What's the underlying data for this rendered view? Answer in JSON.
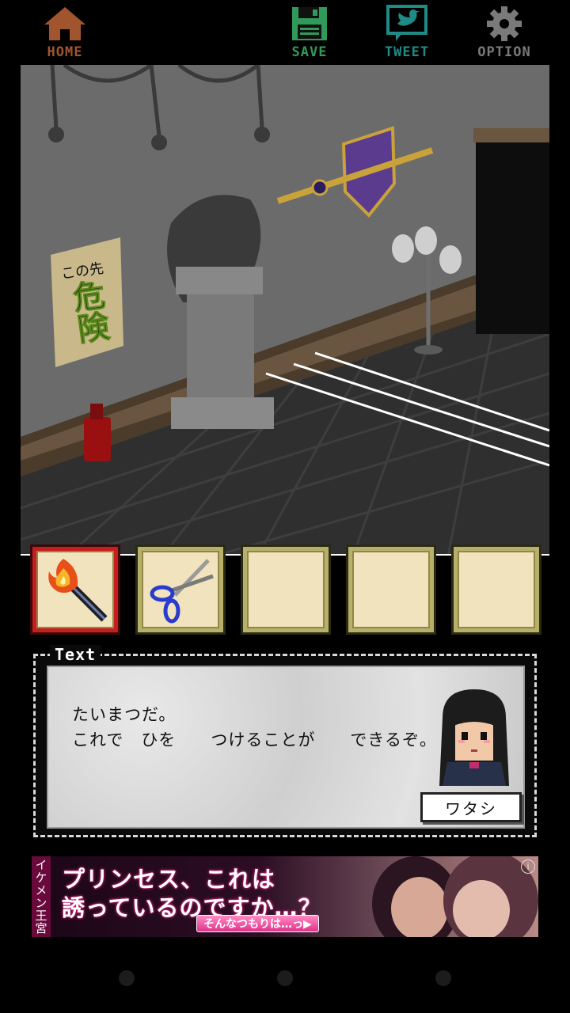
{
  "menu": {
    "home_label": "HOME",
    "save_label": "SAVE",
    "tweet_label": "TWEET",
    "option_label": "OPTION"
  },
  "scene": {
    "poster_line1": "この先",
    "poster_line2": "危険"
  },
  "inventory": {
    "items": [
      {
        "name": "torch",
        "selected": true
      },
      {
        "name": "scissors",
        "selected": false
      },
      {
        "name": "empty",
        "selected": false
      },
      {
        "name": "empty",
        "selected": false
      },
      {
        "name": "empty",
        "selected": false
      }
    ]
  },
  "dialog": {
    "tag": "Text",
    "line1": "たいまつだ。",
    "line2": "これで　ひを　　つけることが　　できるぞ。",
    "speaker": "ワタシ"
  },
  "ad": {
    "brand": "イケメン王宮",
    "headline1": "プリンセス、これは",
    "headline2": "誘っているのですか…？",
    "cta": "そんなつもりは…っ▶",
    "info": "i"
  },
  "colors": {
    "home": "#a0552f",
    "save": "#2f9a5a",
    "tweet": "#1f8a86",
    "option": "#7a7a7a",
    "selected_slot": "#c61e1e",
    "slot": "#b7b06a"
  }
}
